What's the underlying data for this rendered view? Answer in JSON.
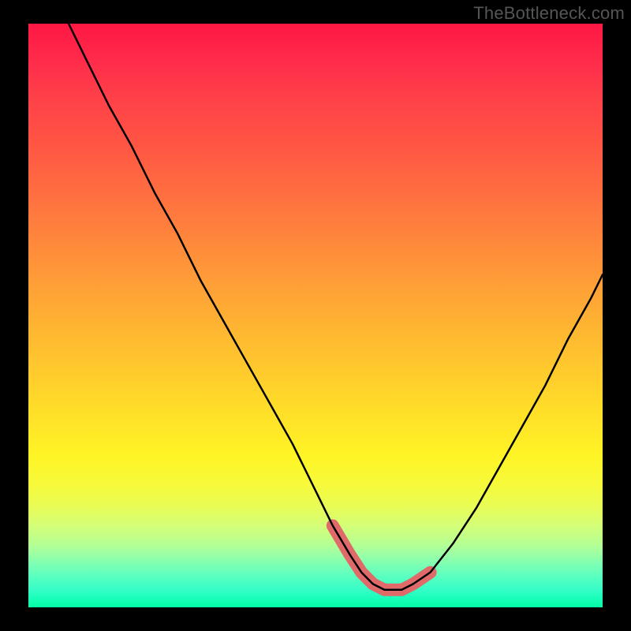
{
  "watermark": "TheBottleneck.com",
  "chart_data": {
    "type": "line",
    "title": "",
    "xlabel": "",
    "ylabel": "",
    "xlim": [
      0,
      100
    ],
    "ylim": [
      0,
      100
    ],
    "legend": false,
    "grid": false,
    "series": [
      {
        "name": "bottleneck-curve",
        "x": [
          7,
          10,
          14,
          18,
          22,
          26,
          30,
          34,
          38,
          42,
          46,
          50,
          53,
          56,
          58,
          60,
          62,
          65,
          67,
          70,
          74,
          78,
          82,
          86,
          90,
          94,
          98,
          100
        ],
        "y": [
          100,
          94,
          86,
          79,
          71,
          64,
          56,
          49,
          42,
          35,
          28,
          20,
          14,
          9,
          6,
          4,
          3,
          3,
          4,
          6,
          11,
          17,
          24,
          31,
          38,
          46,
          53,
          57
        ]
      }
    ],
    "highlight_segment": {
      "name": "optimal-band",
      "x": [
        53,
        56,
        58,
        60,
        62,
        65,
        67,
        70
      ],
      "y": [
        14,
        9,
        6,
        4,
        3,
        3,
        4,
        6
      ]
    },
    "background_gradient": {
      "direction": "vertical",
      "stops": [
        {
          "pos": 0.0,
          "color": "#ff1744"
        },
        {
          "pos": 0.33,
          "color": "#ff7a3e"
        },
        {
          "pos": 0.67,
          "color": "#ffe028"
        },
        {
          "pos": 0.86,
          "color": "#d4fe78"
        },
        {
          "pos": 1.0,
          "color": "#04fda6"
        }
      ]
    }
  }
}
